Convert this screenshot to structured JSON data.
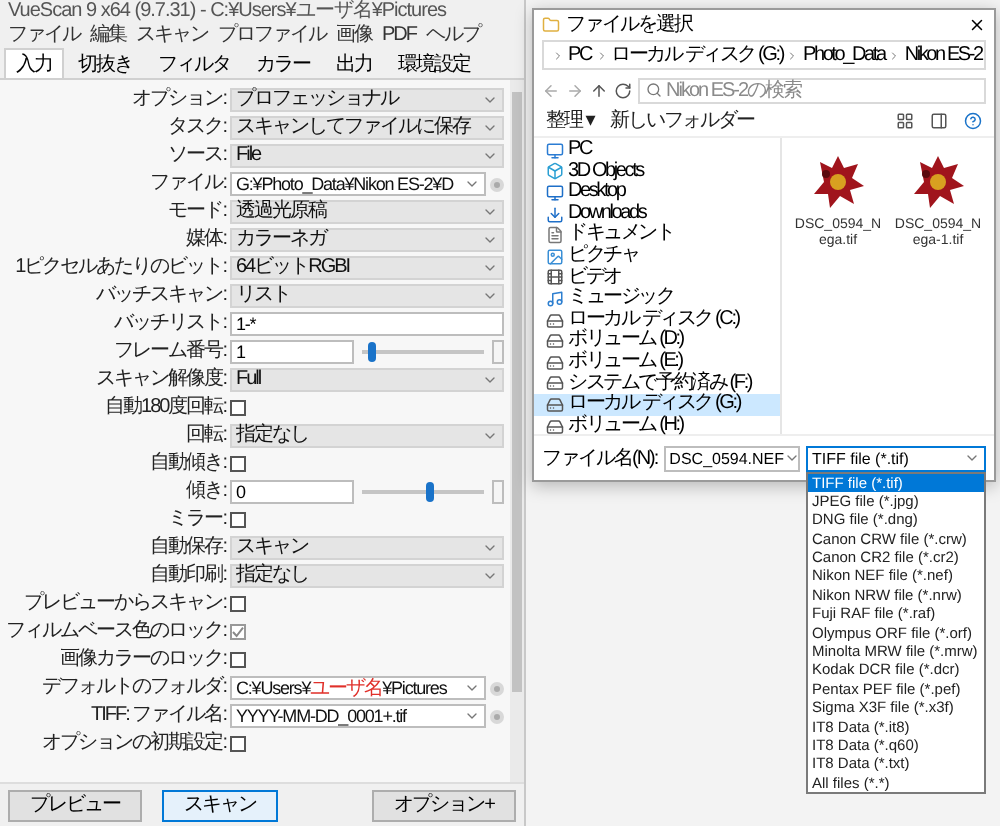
{
  "window": {
    "title": "VueScan 9 x64 (9.7.31) - C:¥Users¥ユーザ名¥Pictures"
  },
  "menu": [
    "ファイル",
    "編集",
    "スキャン",
    "プロファイル",
    "画像",
    "PDF",
    "ヘルプ"
  ],
  "tabs": [
    {
      "label": "入力",
      "selected": true
    },
    {
      "label": "切抜き",
      "selected": false
    },
    {
      "label": "フィルタ",
      "selected": false
    },
    {
      "label": "カラー",
      "selected": false
    },
    {
      "label": "出力",
      "selected": false
    },
    {
      "label": "環境設定",
      "selected": false
    }
  ],
  "rows": [
    {
      "label": "オプション:",
      "kind": "select",
      "value": "プロフェッショナル"
    },
    {
      "label": "タスク:",
      "kind": "select",
      "value": "スキャンしてファイルに保存"
    },
    {
      "label": "ソース:",
      "kind": "select",
      "value": "File"
    },
    {
      "label": "ファイル:",
      "kind": "combo",
      "value_parts": [
        {
          "text": "G:¥Photo_Data¥Nikon ES-2¥D",
          "kind": "plain"
        }
      ]
    },
    {
      "label": "モード:",
      "kind": "select",
      "value": "透過光原稿"
    },
    {
      "label": "媒体:",
      "kind": "select",
      "value": "カラーネガ"
    },
    {
      "label": "1ピクセルあたりのビット:",
      "kind": "select",
      "value": "64ビットRGBI"
    },
    {
      "label": "バッチスキャン:",
      "kind": "select",
      "value": "リスト"
    },
    {
      "label": "バッチリスト:",
      "kind": "text",
      "value": "1-*"
    },
    {
      "label": "フレーム番号:",
      "kind": "slider",
      "value": "1",
      "level": 0.08
    },
    {
      "label": "スキャン解像度:",
      "kind": "select",
      "value": "Full"
    },
    {
      "label": "自動180度回転:",
      "kind": "checkbox",
      "checked": false
    },
    {
      "label": "回転:",
      "kind": "select",
      "value": "指定なし"
    },
    {
      "label": "自動傾き:",
      "kind": "checkbox",
      "checked": false
    },
    {
      "label": "傾き:",
      "kind": "slider",
      "value": "0",
      "level": 0.55
    },
    {
      "label": "ミラー:",
      "kind": "checkbox",
      "checked": false
    },
    {
      "label": "自動保存:",
      "kind": "select",
      "value": "スキャン"
    },
    {
      "label": "自動印刷:",
      "kind": "select",
      "value": "指定なし"
    },
    {
      "label": "プレビューからスキャン:",
      "kind": "checkbox",
      "checked": false
    },
    {
      "label": "フィルムベース色のロック:",
      "kind": "checkbox",
      "checked": true
    },
    {
      "label": "画像カラーのロック:",
      "kind": "checkbox",
      "checked": false
    },
    {
      "label": "デフォルトのフォルダ:",
      "kind": "combo",
      "value_parts": [
        {
          "text": "C:¥Users¥",
          "kind": "plain"
        },
        {
          "text": "ユーザ名",
          "kind": "marked"
        },
        {
          "text": "¥Pictures",
          "kind": "plain"
        }
      ]
    },
    {
      "label": "TIFF: ファイル名:",
      "kind": "combo",
      "value_parts": [
        {
          "text": "YYYY-MM-DD_0001+.tif",
          "kind": "plain"
        }
      ]
    },
    {
      "label": "オプションの初期設定:",
      "kind": "checkbox",
      "checked": false
    }
  ],
  "buttons": [
    {
      "label": "プレビュー",
      "default": false
    },
    {
      "label": "スキャン",
      "default": true
    },
    {
      "label": "オプション+",
      "default": false
    }
  ],
  "dialog": {
    "title": "ファイルを選択",
    "breadcrumb": [
      "PC",
      "ローカル ディスク (G:)",
      "Photo_Data",
      "Nikon ES-2"
    ],
    "search": {
      "placeholder": "Nikon ES-2の検索"
    },
    "toolbar": [
      "整理 ▾",
      "新しいフォルダー"
    ],
    "nav": [
      {
        "label": "PC",
        "kind": "pc",
        "selected": false
      },
      {
        "label": "3D Objects",
        "kind": "objects",
        "selected": false
      },
      {
        "label": "Desktop",
        "kind": "desktop",
        "selected": false
      },
      {
        "label": "Downloads",
        "kind": "downloads",
        "selected": false
      },
      {
        "label": "ドキュメント",
        "kind": "docs",
        "selected": false
      },
      {
        "label": "ピクチャ",
        "kind": "pictures",
        "selected": false
      },
      {
        "label": "ビデオ",
        "kind": "videos",
        "selected": false
      },
      {
        "label": "ミュージック",
        "kind": "music",
        "selected": false
      },
      {
        "label": "ローカル ディスク (C:)",
        "kind": "drive",
        "selected": false
      },
      {
        "label": "ボリューム (D:)",
        "kind": "drive",
        "selected": false
      },
      {
        "label": "ボリューム (E:)",
        "kind": "drive",
        "selected": false
      },
      {
        "label": "システムで予約済み (F:)",
        "kind": "drive",
        "selected": false
      },
      {
        "label": "ローカル ディスク (G:)",
        "kind": "drive",
        "selected": true
      },
      {
        "label": "ボリューム (H:)",
        "kind": "drive",
        "selected": false
      }
    ],
    "files": [
      {
        "name": "DSC_0594_Nega.tif"
      },
      {
        "name": "DSC_0594_Nega-1.tif"
      }
    ],
    "filename_label": "ファイル名(N):",
    "filename": "DSC_0594.NEF",
    "filetype": "TIFF file (*.tif)",
    "filetypes": [
      {
        "label": "TIFF file (*.tif)",
        "selected": true
      },
      {
        "label": "JPEG file (*.jpg)",
        "selected": false
      },
      {
        "label": "DNG file (*.dng)",
        "selected": false
      },
      {
        "label": "Canon CRW file (*.crw)",
        "selected": false
      },
      {
        "label": "Canon CR2 file (*.cr2)",
        "selected": false
      },
      {
        "label": "Nikon NEF file (*.nef)",
        "selected": false
      },
      {
        "label": "Nikon NRW file (*.nrw)",
        "selected": false
      },
      {
        "label": "Fuji RAF file (*.raf)",
        "selected": false
      },
      {
        "label": "Olympus ORF file (*.orf)",
        "selected": false
      },
      {
        "label": "Minolta MRW file (*.mrw)",
        "selected": false
      },
      {
        "label": "Kodak DCR file (*.dcr)",
        "selected": false
      },
      {
        "label": "Pentax PEF file (*.pef)",
        "selected": false
      },
      {
        "label": "Sigma X3F file (*.x3f)",
        "selected": false
      },
      {
        "label": "IT8 Data (*.it8)",
        "selected": false
      },
      {
        "label": "IT8 Data (*.q60)",
        "selected": false
      },
      {
        "label": "IT8 Data (*.txt)",
        "selected": false
      },
      {
        "label": "All files (*.*)",
        "selected": false
      }
    ]
  }
}
